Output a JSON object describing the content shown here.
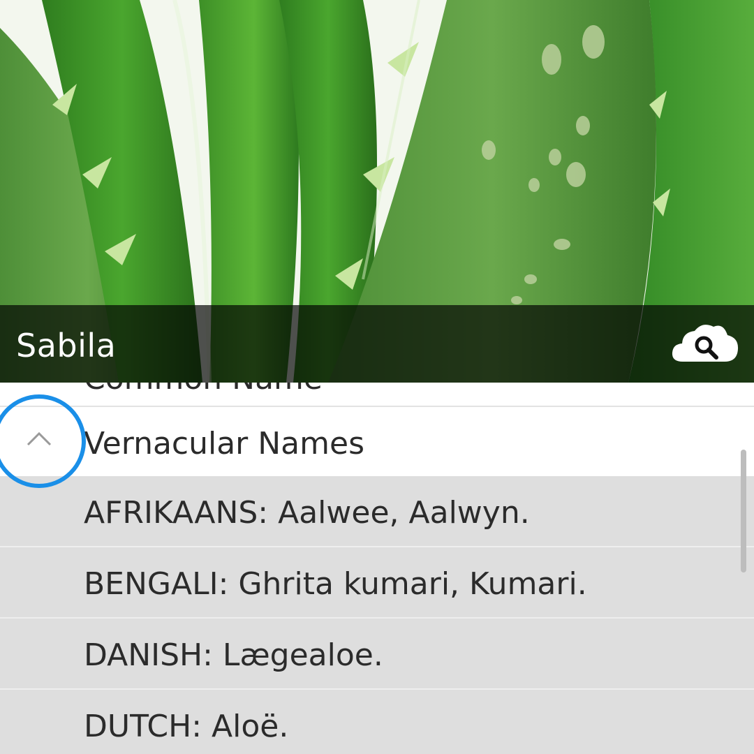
{
  "header": {
    "title": "Sabila",
    "hero_image": "aloe-vera-leaves",
    "action_icon": "cloud-search-icon"
  },
  "list": {
    "partial_header": "Common Name",
    "section": {
      "label": "Vernacular Names",
      "toggle_icon": "chevron-up-icon",
      "expanded": true
    },
    "rows": [
      "AFRIKAANS: Aalwee, Aalwyn.",
      "BENGALI: Ghrita kumari, Kumari.",
      "DANISH: Lægealoe.",
      "DUTCH: Aloë."
    ]
  },
  "colors": {
    "focus_ring": "#1a8fe8",
    "row_background": "#dedede",
    "title_overlay": "rgba(0,0,0,0.68)"
  }
}
